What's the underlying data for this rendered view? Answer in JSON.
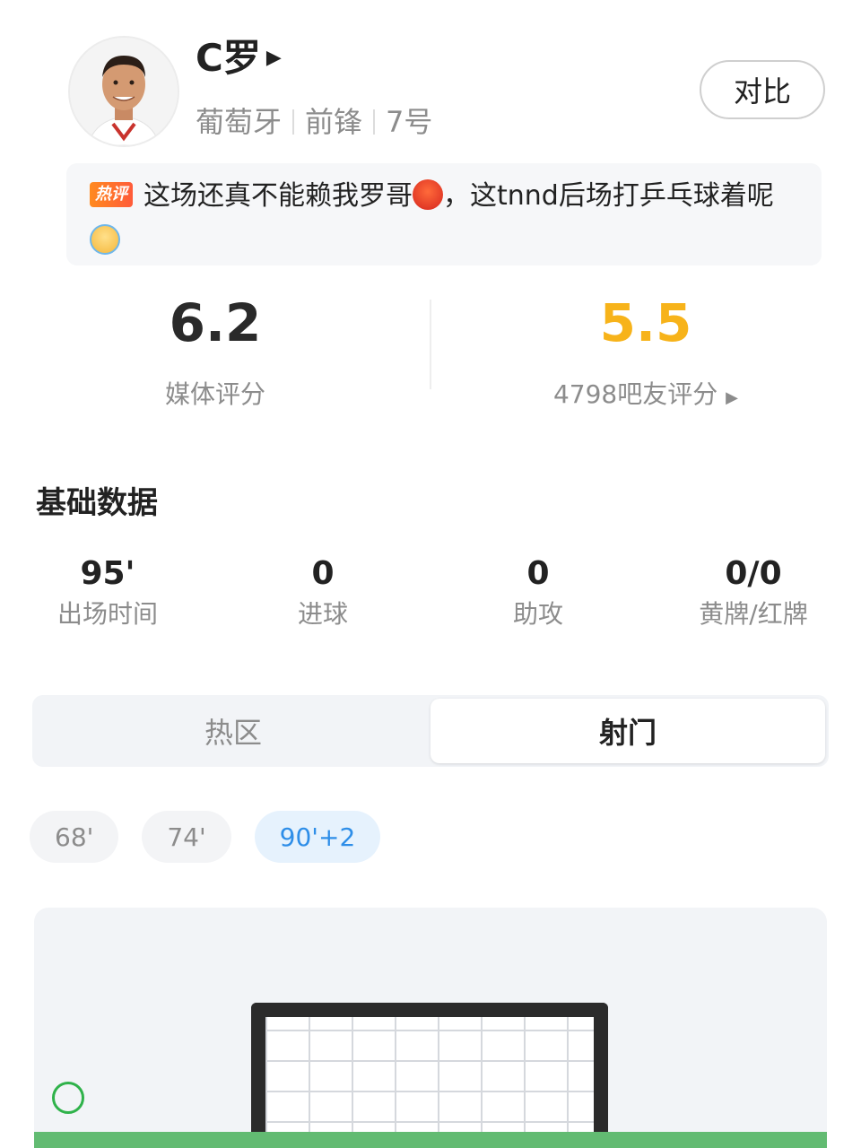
{
  "player": {
    "name": "C罗",
    "country": "葡萄牙",
    "position": "前锋",
    "number": "7号",
    "avatar_icon": "player-avatar-photo"
  },
  "actions": {
    "compare_label": "对比"
  },
  "hot_comment": {
    "badge": "热评",
    "text_part1": "这场还真不能赖我罗哥",
    "text_part2": "，这tnnd后场打乒乓球着呢",
    "emoji1": "angry-face-emoji",
    "emoji2": "facepalm-emoji"
  },
  "ratings": {
    "media_value": "6.2",
    "media_label": "媒体评分",
    "fans_value": "5.5",
    "fans_label": "4798吧友评分",
    "fans_color": "#f7b31a"
  },
  "basic_stats": {
    "title": "基础数据",
    "items": [
      {
        "value": "95'",
        "label": "出场时间"
      },
      {
        "value": "0",
        "label": "进球"
      },
      {
        "value": "0",
        "label": "助攻"
      },
      {
        "value": "0/0",
        "label": "黄牌/红牌"
      }
    ]
  },
  "tabs": [
    {
      "label": "热区",
      "active": false
    },
    {
      "label": "射门",
      "active": true
    }
  ],
  "time_chips": [
    {
      "label": "68'",
      "active": false
    },
    {
      "label": "74'",
      "active": false
    },
    {
      "label": "90'+2",
      "active": true
    }
  ],
  "colors": {
    "accent_blue": "#2e8ee8",
    "pitch_green": "#62bb72",
    "shot_marker": "#2fb24a"
  }
}
